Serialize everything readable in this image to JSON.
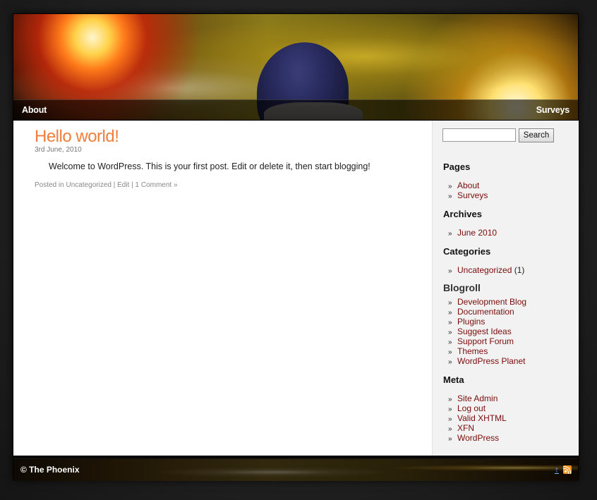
{
  "nav": {
    "left": "About",
    "right": "Surveys"
  },
  "post": {
    "title": "Hello world!",
    "date": "3rd June, 2010",
    "body": "Welcome to WordPress. This is your first post. Edit or delete it, then start blogging!",
    "meta_prefix": "Posted in ",
    "category": "Uncategorized",
    "sep1": " | ",
    "edit": "Edit",
    "sep2": " | ",
    "comments": "1 Comment »"
  },
  "search": {
    "button": "Search",
    "value": ""
  },
  "sidebar": {
    "pages": {
      "title": "Pages",
      "items": [
        "About",
        "Surveys"
      ]
    },
    "archives": {
      "title": "Archives",
      "items": [
        "June 2010"
      ]
    },
    "categories": {
      "title": "Categories",
      "items": [
        {
          "label": "Uncategorized",
          "count": " (1)"
        }
      ]
    },
    "blogroll": {
      "title": "Blogroll",
      "items": [
        "Development Blog",
        "Documentation",
        "Plugins",
        "Suggest Ideas",
        "Support Forum",
        "Themes",
        "WordPress Planet"
      ]
    },
    "meta": {
      "title": "Meta",
      "items": [
        "Site Admin",
        "Log out",
        "Valid XHTML",
        "XFN",
        "WordPress"
      ]
    }
  },
  "bullet": "»",
  "footer": {
    "copyright": "© The Phoenix",
    "up_arrow": "↑",
    "up_icon": "arrow-up-icon",
    "rss_icon": "rss-icon"
  },
  "colors": {
    "title": "#f07e3c",
    "link": "#7a0b0b",
    "sidebar_bg": "#f2f2f2"
  }
}
